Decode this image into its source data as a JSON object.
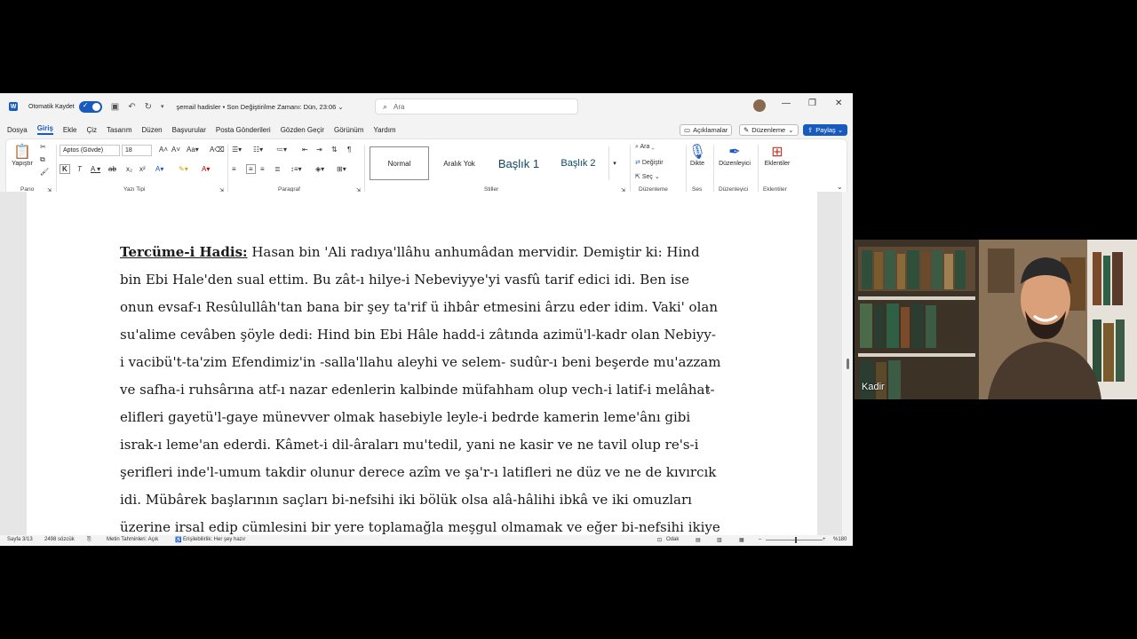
{
  "titlebar": {
    "autosave_label": "Otomatik Kaydet",
    "doc_title": "şemail hadisler • Son Değiştirilme Zamanı: Dün, 23:06 ⌄",
    "search_placeholder": "Ara"
  },
  "menu": {
    "tabs": [
      "Dosya",
      "Giriş",
      "Ekle",
      "Çiz",
      "Tasarım",
      "Düzen",
      "Başvurular",
      "Posta Gönderileri",
      "Gözden Geçir",
      "Görünüm",
      "Yardım"
    ],
    "active_tab": "Giriş",
    "comments": "Açıklamalar",
    "editing": "Düzenleme",
    "share": "Paylaş"
  },
  "ribbon": {
    "paste": "Yapıştır",
    "clipboard": "Pano",
    "font_name": "Aptos (Gövde)",
    "font_size": "18",
    "font_group": "Yazı Tipi",
    "paragraph_group": "Paragraf",
    "styles": [
      "Normal",
      "Aralık Yok",
      "Başlık 1",
      "Başlık 2"
    ],
    "styles_group": "Stiller",
    "find": "Ara",
    "replace": "Değiştir",
    "select": "Seç",
    "editing_group": "Düzenleme",
    "dictate": "Dikte",
    "voice_group": "Ses",
    "editor": "Düzenleyici",
    "editor_group": "Düzenleyici",
    "addins": "Eklentiler",
    "addins_group": "Eklentiler"
  },
  "document": {
    "heading": "Tercüme-i Hadis:",
    "lines": [
      " Hasan bin 'Ali radıya'llâhu anhumâdan mervidir. Demiştir ki: Hind",
      "bin Ebi Hale'den sual ettim. Bu zât-ı hilye-i Nebeviyye'yi vasfû tarif edici idi. Ben ise",
      "onun evsaf-ı Resûlullâh'tan bana bir şey ta'rif ü ihbâr etmesini ârzu eder idim. Vaki' olan",
      "su'alime cevâben şöyle dedi: Hind bin Ebi Hâle hadd-i zâtında azimü'l-kadr olan Nebiyy-",
      "i vacibü't-ta'zim Efendimiz'in -salla'llahu aleyhi ve selem- sudûr-ı beni beşerde mu'azzam",
      "ve safha-i ruhsârına atf-ı nazar edenlerin kalbinde müfahham olup vech-i latif-i melâhat-",
      "elifleri gayetü'l-gaye münevver olmak hasebiyle leyle-i bedrde kamerin leme'ânı gibi",
      "israk-ı leme'an ederdi. Kâmet-i dil-âraları mu'tedil, yani ne kasir ve ne tavil olup re's-i",
      "şerifleri inde'l-umum takdir olunur derece azîm ve şa'r-ı latifleri ne düz ve ne de kıvırcık",
      "idi. Mübârek başlarının saçları bi-nefsihi iki bölük olsa alâ-hâlihi ibkâ ve iki omuzları",
      "üzerine irsal edip cümlesini bir yere toplamağla meşgul olmamak ve eğer bi-nefsihi ikiye"
    ]
  },
  "status": {
    "page": "Sayfa 3/13",
    "words": "2498 sözcük",
    "predictions": "Metin Tahminleri: Açık",
    "accessibility": "Erişilebilirlik: Her şey hazır",
    "focus": "Odak",
    "zoom": "%180"
  },
  "video": {
    "participant_name": "Kadir"
  }
}
